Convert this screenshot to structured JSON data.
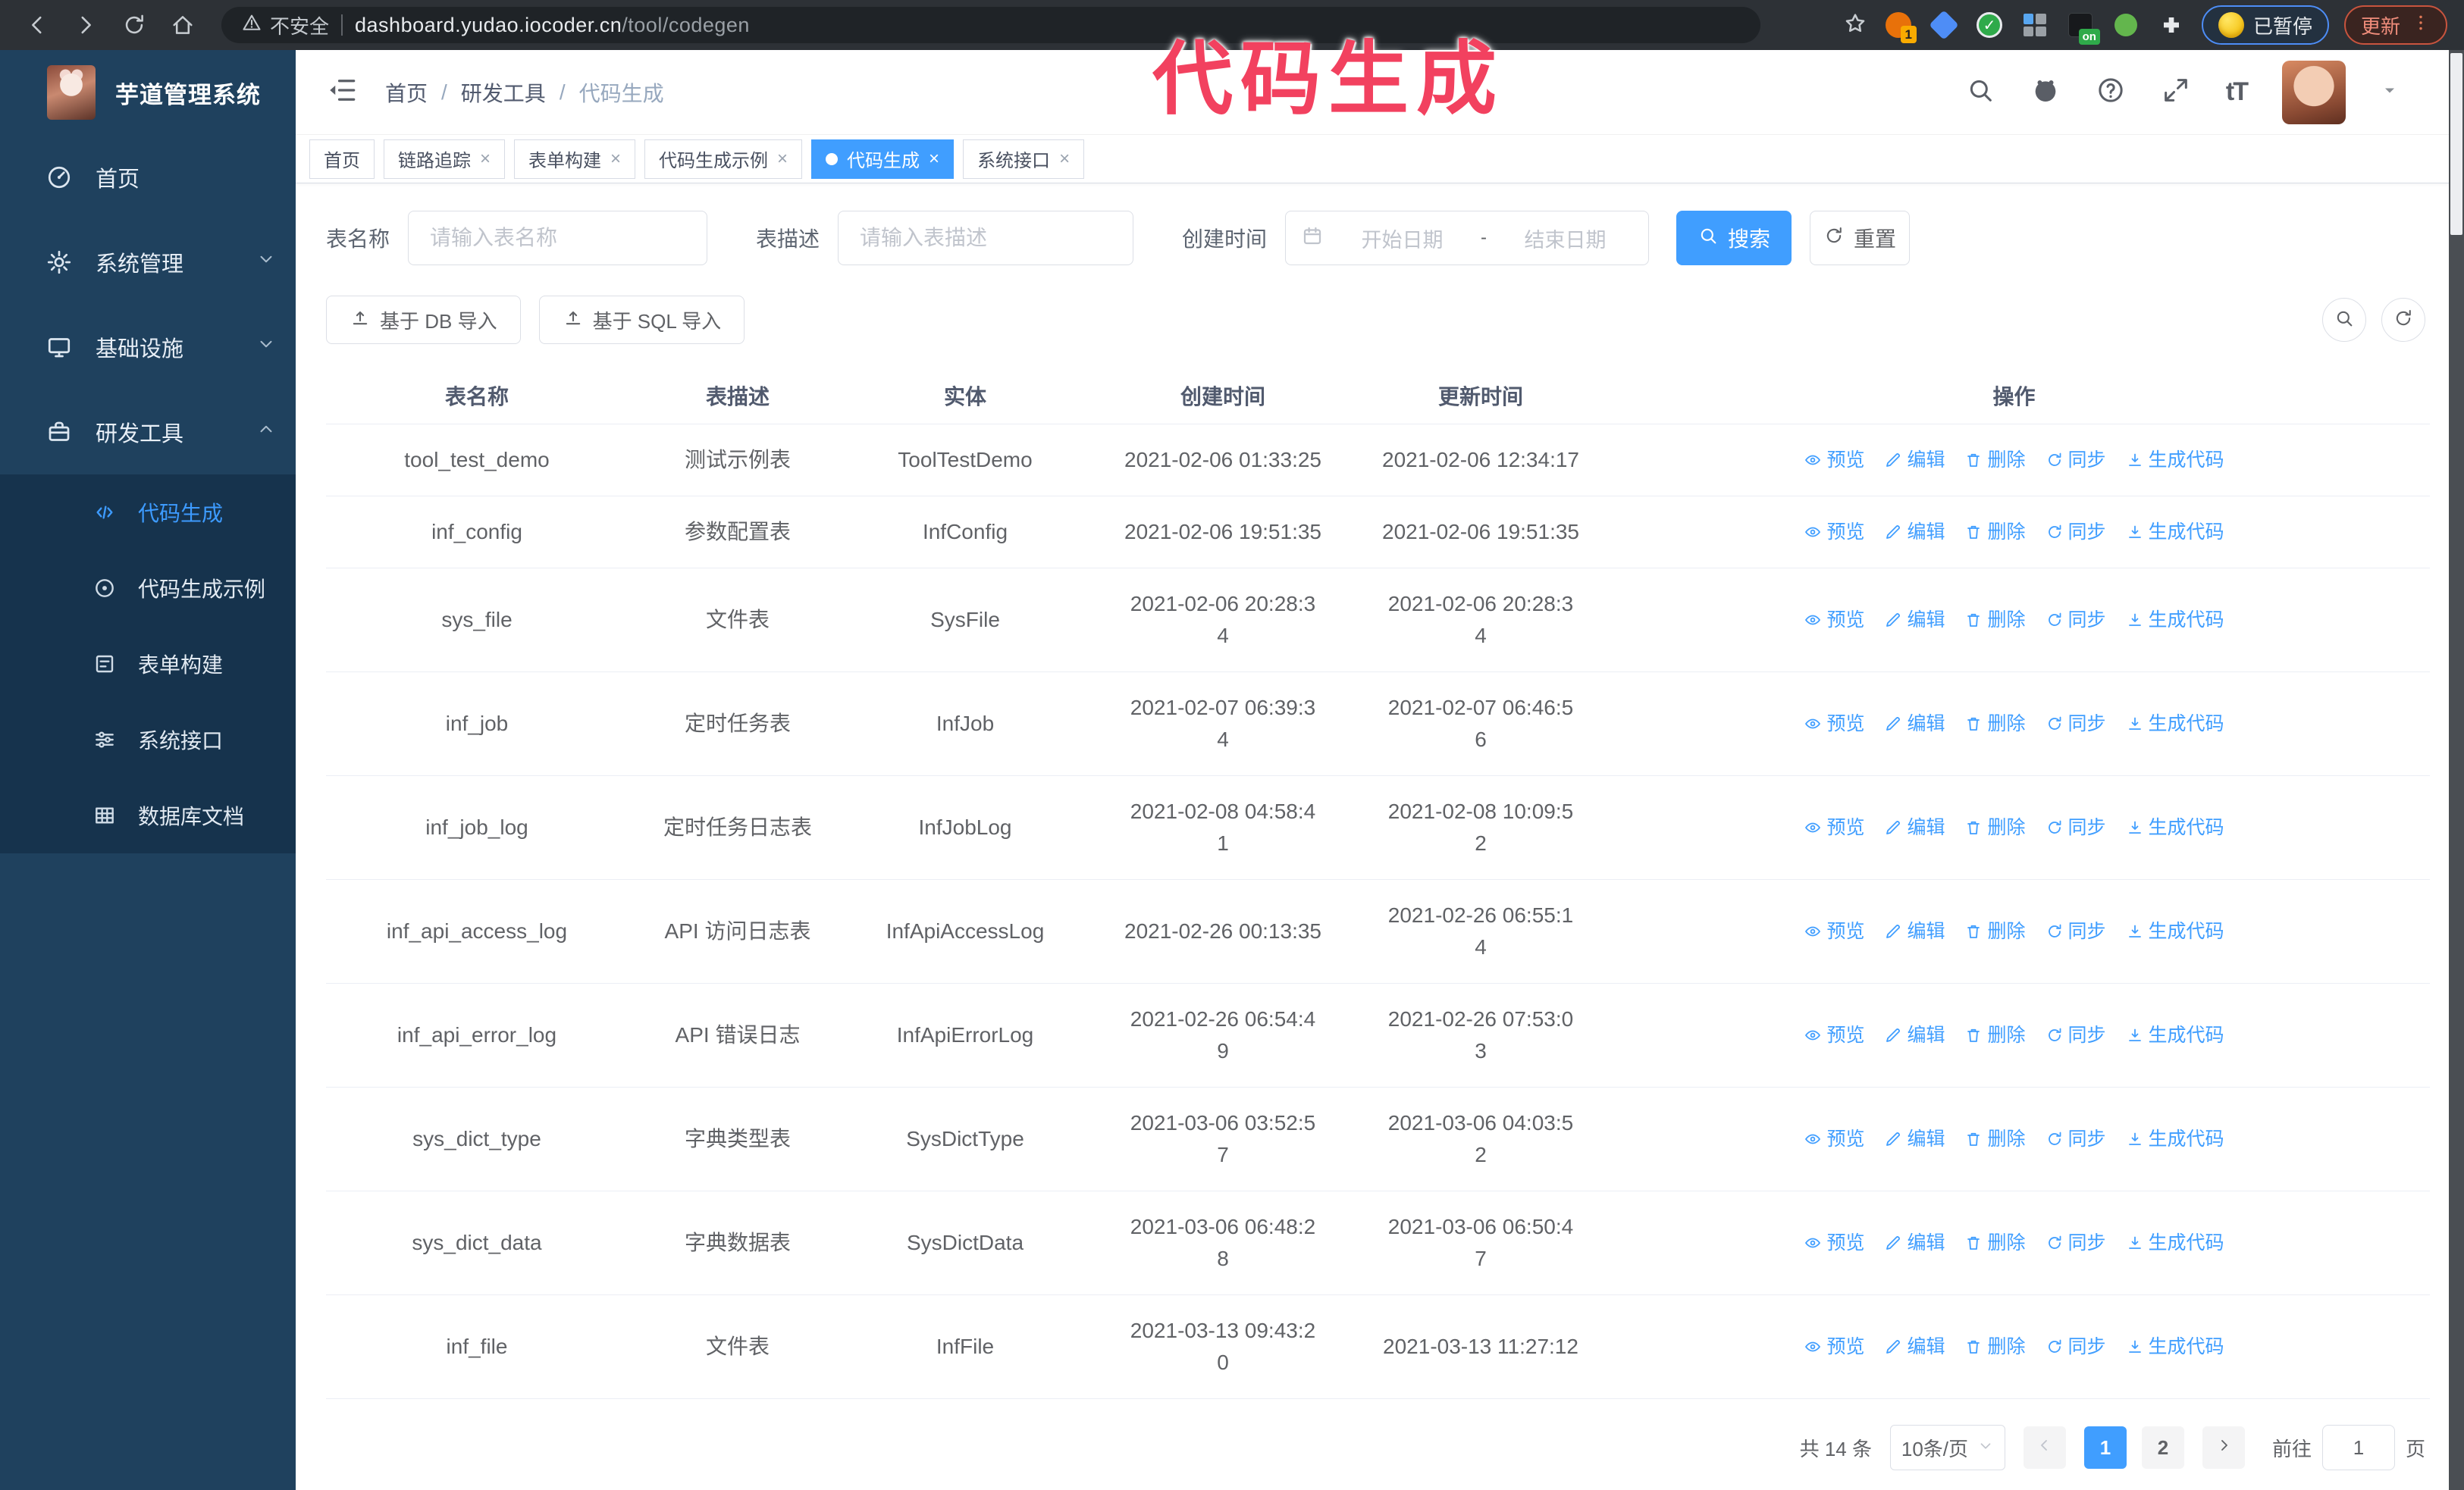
{
  "colors": {
    "accent": "#409eff",
    "annotation": "#f2415f",
    "sidebar_bg": "#1f415e",
    "submenu_bg": "#16334d"
  },
  "annotation": {
    "text": "代码生成"
  },
  "browser": {
    "nav_icons": [
      "back-icon",
      "forward-icon",
      "reload-icon",
      "home-icon"
    ],
    "insecure_label": "不安全",
    "url_host": "dashboard.yudao.iocoder.cn",
    "url_path": "/tool/codegen",
    "extension_badge": "1",
    "extension_on_badge": "on",
    "paused_badge": "已暂停",
    "update_button": "更新"
  },
  "sidebar": {
    "app_title": "芋道管理系统",
    "items": [
      {
        "label": "首页",
        "icon": "gauge-icon",
        "chevron": null,
        "active": false
      },
      {
        "label": "系统管理",
        "icon": "gear-icon",
        "chevron": "down",
        "active": false
      },
      {
        "label": "基础设施",
        "icon": "monitor-icon",
        "chevron": "down",
        "active": false
      },
      {
        "label": "研发工具",
        "icon": "toolbox-icon",
        "chevron": "up",
        "active": true
      }
    ],
    "submenu": [
      {
        "label": "代码生成",
        "icon": "code-icon",
        "active": true
      },
      {
        "label": "代码生成示例",
        "icon": "example-icon",
        "active": false
      },
      {
        "label": "表单构建",
        "icon": "form-icon",
        "active": false
      },
      {
        "label": "系统接口",
        "icon": "sliders-icon",
        "active": false
      },
      {
        "label": "数据库文档",
        "icon": "db-doc-icon",
        "active": false
      }
    ]
  },
  "header": {
    "breadcrumb": [
      "首页",
      "研发工具",
      "代码生成"
    ],
    "icon_buttons": [
      "search-icon",
      "github-icon",
      "help-icon",
      "fullscreen-icon",
      "font-size-icon",
      "avatar",
      "caret-down-icon"
    ]
  },
  "tabs": [
    {
      "label": "首页",
      "closable": false,
      "active": false
    },
    {
      "label": "链路追踪",
      "closable": true,
      "active": false
    },
    {
      "label": "表单构建",
      "closable": true,
      "active": false
    },
    {
      "label": "代码生成示例",
      "closable": true,
      "active": false
    },
    {
      "label": "代码生成",
      "closable": true,
      "active": true
    },
    {
      "label": "系统接口",
      "closable": true,
      "active": false
    }
  ],
  "search_form": {
    "name_label": "表名称",
    "name_placeholder": "请输入表名称",
    "desc_label": "表描述",
    "desc_placeholder": "请输入表描述",
    "time_label": "创建时间",
    "start_placeholder": "开始日期",
    "range_separator": "-",
    "end_placeholder": "结束日期",
    "search_button": "搜索",
    "reset_button": "重置"
  },
  "toolbar": {
    "import_db": "基于 DB 导入",
    "import_sql": "基于 SQL 导入",
    "right_icons": [
      "search-icon",
      "refresh-icon"
    ]
  },
  "table": {
    "columns": [
      "表名称",
      "表描述",
      "实体",
      "创建时间",
      "更新时间",
      "操作"
    ],
    "actions": [
      {
        "label": "预览",
        "icon": "eye-icon"
      },
      {
        "label": "编辑",
        "icon": "edit-icon"
      },
      {
        "label": "删除",
        "icon": "delete-icon"
      },
      {
        "label": "同步",
        "icon": "sync-icon"
      },
      {
        "label": "生成代码",
        "icon": "download-icon"
      }
    ],
    "rows": [
      {
        "name": "tool_test_demo",
        "desc": "测试示例表",
        "entity": "ToolTestDemo",
        "created": "2021-02-06 01:33:25",
        "updated": "2021-02-06 12:34:17"
      },
      {
        "name": "inf_config",
        "desc": "参数配置表",
        "entity": "InfConfig",
        "created": "2021-02-06 19:51:35",
        "updated": "2021-02-06 19:51:35"
      },
      {
        "name": "sys_file",
        "desc": "文件表",
        "entity": "SysFile",
        "created": "2021-02-06 20:28:3\n4",
        "updated": "2021-02-06 20:28:3\n4"
      },
      {
        "name": "inf_job",
        "desc": "定时任务表",
        "entity": "InfJob",
        "created": "2021-02-07 06:39:3\n4",
        "updated": "2021-02-07 06:46:5\n6"
      },
      {
        "name": "inf_job_log",
        "desc": "定时任务日志表",
        "entity": "InfJobLog",
        "created": "2021-02-08 04:58:4\n1",
        "updated": "2021-02-08 10:09:5\n2"
      },
      {
        "name": "inf_api_access_log",
        "desc": "API 访问日志表",
        "entity": "InfApiAccessLog",
        "created": "2021-02-26 00:13:35",
        "updated": "2021-02-26 06:55:1\n4"
      },
      {
        "name": "inf_api_error_log",
        "desc": "API 错误日志",
        "entity": "InfApiErrorLog",
        "created": "2021-02-26 06:54:4\n9",
        "updated": "2021-02-26 07:53:0\n3"
      },
      {
        "name": "sys_dict_type",
        "desc": "字典类型表",
        "entity": "SysDictType",
        "created": "2021-03-06 03:52:5\n7",
        "updated": "2021-03-06 04:03:5\n2"
      },
      {
        "name": "sys_dict_data",
        "desc": "字典数据表",
        "entity": "SysDictData",
        "created": "2021-03-06 06:48:2\n8",
        "updated": "2021-03-06 06:50:4\n7"
      },
      {
        "name": "inf_file",
        "desc": "文件表",
        "entity": "InfFile",
        "created": "2021-03-13 09:43:2\n0",
        "updated": "2021-03-13 11:27:12"
      }
    ]
  },
  "pagination": {
    "total": "共 14 条",
    "page_size": "10条/页",
    "pages": [
      "1",
      "2"
    ],
    "current": "1",
    "goto_label": "前往",
    "goto_value": "1",
    "unit": "页"
  }
}
